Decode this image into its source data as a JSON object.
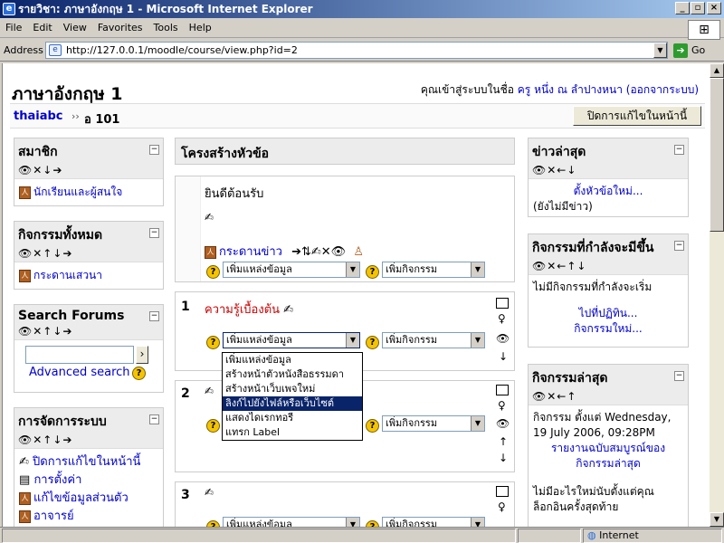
{
  "window": {
    "title": "รายวิชา: ภาษาอังกฤษ 1 - Microsoft Internet Explorer",
    "buttons": [
      "_",
      "▫",
      "×"
    ]
  },
  "menu": [
    "File",
    "Edit",
    "View",
    "Favorites",
    "Tools",
    "Help"
  ],
  "address": {
    "label": "Address",
    "url": "http://127.0.0.1/moodle/course/view.php?id=2",
    "go_label": "Go"
  },
  "page": {
    "course_title": "ภาษาอังกฤษ 1",
    "login_prefix": "คุณเข้าสู่ระบบในชื่อ",
    "login_user": "ครู หนึ่ง ณ ลำปางหนา",
    "login_logout": "(ออกจากระบบ)",
    "breadcrumb_home": "thaiabc",
    "breadcrumb_sep": "››",
    "breadcrumb_current": "อ 101",
    "edit_off_button": "ปิดการแก้ไขในหน้านี้"
  },
  "left_blocks": {
    "members": {
      "title": "สมาชิก",
      "icons": "👁✕↓➔",
      "item": "นักเรียนและผู้สนใจ"
    },
    "activities": {
      "title": "กิจกรรมทั้งหมด",
      "icons": "👁✕↑↓➔",
      "item": "กระดานเสวนา"
    },
    "search": {
      "title": "Search Forums",
      "icons": "👁✕↑↓➔",
      "input_value": "",
      "go": "›",
      "advanced": "Advanced search"
    },
    "admin": {
      "title": "การจัดการระบบ",
      "icons": "👁✕↑↓➔",
      "items": [
        "ปิดการแก้ไขในหน้านี้",
        "การตั้งค่า",
        "แก้ไขข้อมูลส่วนตัว",
        "อาจารย์"
      ]
    }
  },
  "center": {
    "header": "โครงสร้างหัวข้อ",
    "topic0": {
      "welcome": "ยินดีต้อนรับ",
      "forum_link": "กระดานข่าว",
      "forum_icons": "➔⇅✍✕👁",
      "add_resource": "เพิ่มแหล่งข้อมูล",
      "add_activity": "เพิ่มกิจกรรม"
    },
    "topic1": {
      "num": "1",
      "title": "ความรู้เบื้องต้น",
      "add_resource": "เพิ่มแหล่งข้อมูล",
      "add_activity": "เพิ่มกิจกรรม"
    },
    "topic2": {
      "num": "2",
      "add_activity": "เพิ่มกิจกรรม"
    },
    "topic3": {
      "num": "3",
      "add_resource": "เพิ่มแหล่งข้อมูล",
      "add_activity": "เพิ่มกิจกรรม"
    },
    "dropdown_options": [
      "เพิ่มแหล่งข้อมูล",
      "สร้างหน้าตัวหนังสือธรรมดา",
      "สร้างหน้าเว็บเพจใหม่",
      "ลิงก์ไปยังไฟล์หรือเว็บไซต์",
      "แสดงไดเรกทอรี",
      "แทรก Label"
    ],
    "dropdown_selected_index": 3
  },
  "right_blocks": {
    "news": {
      "title": "ข่าวล่าสุด",
      "icons": "👁✕←↓",
      "add_topic": "ตั้งหัวข้อใหม่...",
      "empty": "(ยังไม่มีข่าว)"
    },
    "upcoming": {
      "title": "กิจกรรมที่กำลังจะมีขึ้น",
      "icons": "👁✕←↑↓",
      "empty": "ไม่มีกิจกรรมที่กำลังจะเริ่ม",
      "calendar_link": "ไปที่ปฏิทิน...",
      "new_event": "กิจกรรมใหม่..."
    },
    "recent": {
      "title": "กิจกรรมล่าสุด",
      "icons": "👁✕←↑",
      "since": "กิจกรรม ตั้งแต่ Wednesday, 19 July 2006, 09:28PM",
      "report_link": "รายงานฉบับสมบูรณ์ของกิจกรรมล่าสุด",
      "nothing_new": "ไม่มีอะไรใหม่นับตั้งแต่คุณล็อกอินครั้งสุดท้าย"
    }
  },
  "status": {
    "zone": "Internet"
  },
  "colors": {
    "link": "#0000cc",
    "topic_title": "#cc0000",
    "titlebar": "#0a246a"
  }
}
